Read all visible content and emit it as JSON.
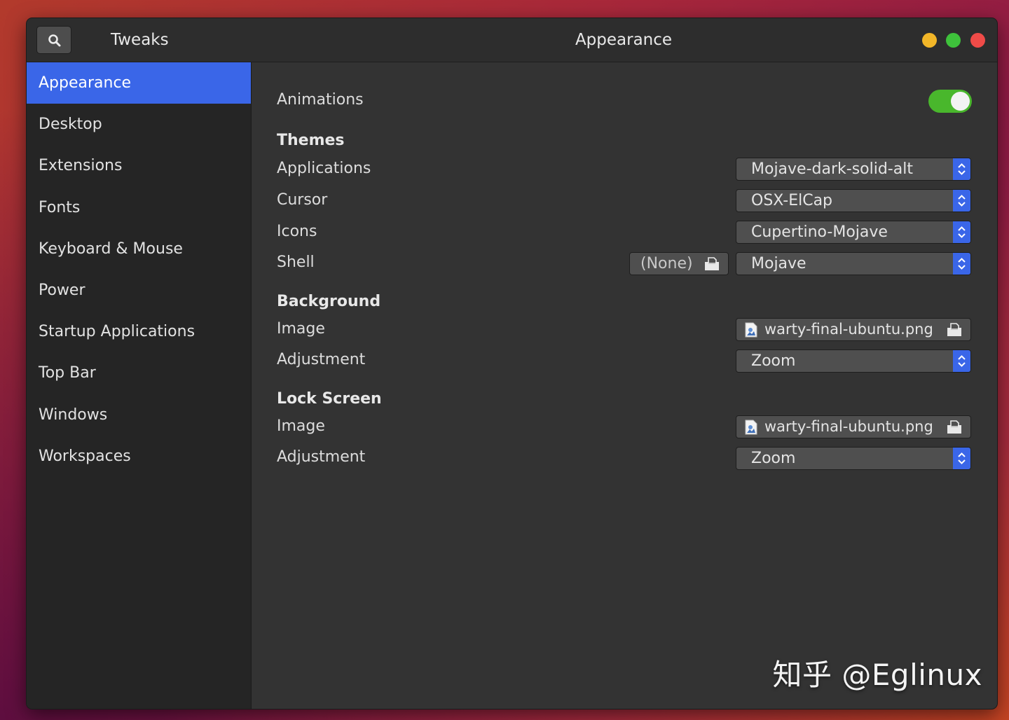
{
  "window": {
    "app_title": "Tweaks",
    "page_title": "Appearance"
  },
  "sidebar": {
    "items": [
      {
        "label": "Appearance",
        "active": true
      },
      {
        "label": "Desktop",
        "active": false
      },
      {
        "label": "Extensions",
        "active": false
      },
      {
        "label": "Fonts",
        "active": false
      },
      {
        "label": "Keyboard & Mouse",
        "active": false
      },
      {
        "label": "Power",
        "active": false
      },
      {
        "label": "Startup Applications",
        "active": false
      },
      {
        "label": "Top Bar",
        "active": false
      },
      {
        "label": "Windows",
        "active": false
      },
      {
        "label": "Workspaces",
        "active": false
      }
    ]
  },
  "content": {
    "animations": {
      "label": "Animations",
      "enabled": true
    },
    "themes": {
      "heading": "Themes",
      "applications": {
        "label": "Applications",
        "value": "Mojave-dark-solid-alt"
      },
      "cursor": {
        "label": "Cursor",
        "value": "OSX-ElCap"
      },
      "icons": {
        "label": "Icons",
        "value": "Cupertino-Mojave"
      },
      "shell": {
        "label": "Shell",
        "file_value": "(None)",
        "value": "Mojave"
      }
    },
    "background": {
      "heading": "Background",
      "image": {
        "label": "Image",
        "value": "warty-final-ubuntu.png"
      },
      "adjustment": {
        "label": "Adjustment",
        "value": "Zoom"
      }
    },
    "lock_screen": {
      "heading": "Lock Screen",
      "image": {
        "label": "Image",
        "value": "warty-final-ubuntu.png"
      },
      "adjustment": {
        "label": "Adjustment",
        "value": "Zoom"
      }
    }
  },
  "watermark": "知乎 @Eglinux",
  "colors": {
    "accent": "#3a66e8",
    "toggle_on": "#49b72c",
    "minimize": "#f2b628",
    "maximize": "#3ec23b",
    "close": "#ef4b48"
  }
}
